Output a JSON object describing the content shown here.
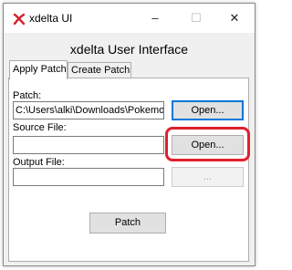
{
  "window": {
    "title": "xdelta UI",
    "controls": {
      "minimize": "–",
      "maximize": "☐",
      "close": "✕"
    }
  },
  "header": {
    "title": "xdelta User Interface"
  },
  "tabs": [
    {
      "label": "Apply Patch",
      "active": true
    },
    {
      "label": "Create Patch",
      "active": false
    }
  ],
  "form": {
    "patch": {
      "label": "Patch:",
      "value": "C:\\Users\\alki\\Downloads\\Pokemor",
      "button": "Open..."
    },
    "source": {
      "label": "Source File:",
      "value": "",
      "button": "Open..."
    },
    "output": {
      "label": "Output File:",
      "value": "",
      "button": "..."
    },
    "submit": "Patch"
  },
  "colors": {
    "highlight": "#e1202a",
    "focus": "#0078d7",
    "icon": "#d21f2b"
  }
}
